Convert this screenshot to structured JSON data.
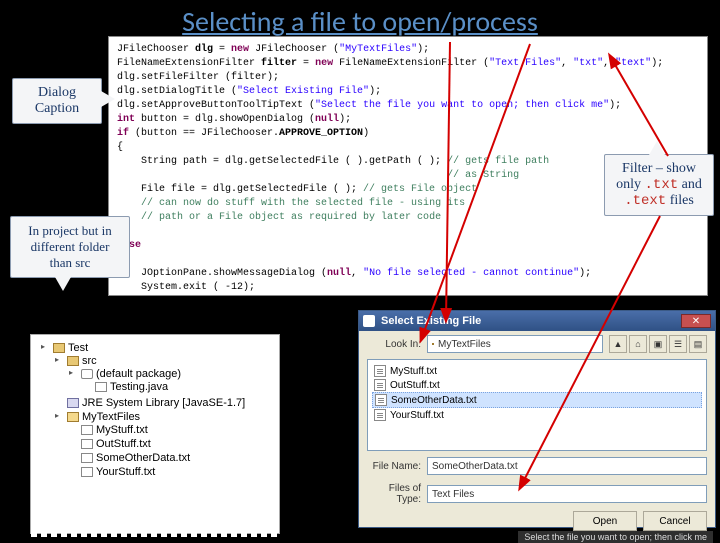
{
  "title": "Selecting a file to open/process",
  "callouts": {
    "dialog_caption": "Dialog Caption",
    "in_project": "In project but in different folder than src",
    "filter_line1": "Filter – show",
    "filter_line2a": "only",
    "filter_ext1": ".txt",
    "filter_line2b": "and",
    "filter_ext2": ".text",
    "filter_line3": "files"
  },
  "code_lines": [
    {
      "html": "JFileChooser <span class='type'>dlg</span> = <span class='kw'>new</span> JFileChooser (<span class='str'>\"MyTextFiles\"</span>);"
    },
    {
      "html": "FileNameExtensionFilter <span class='type'>filter</span> = <span class='kw'>new</span> FileNameExtensionFilter (<span class='str'>\"Text Files\"</span>, <span class='str'>\"txt\"</span>, <span class='str'>\"text\"</span>);"
    },
    {
      "html": "dlg.setFileFilter (filter);"
    },
    {
      "html": "dlg.setDialogTitle (<span class='str'>\"Select Existing File\"</span>);"
    },
    {
      "html": "dlg.setApproveButtonToolTipText (<span class='str'>\"Select the file you want to open; then click me\"</span>);"
    },
    {
      "html": "<span class='kw'>int</span> button = dlg.showOpenDialog (<span class='kw'>null</span>);"
    },
    {
      "html": "<span class='kw'>if</span> (button == JFileChooser.<span class='type'>APPROVE_OPTION</span>)"
    },
    {
      "html": "{"
    },
    {
      "html": "    String path = dlg.getSelectedFile ( ).getPath ( ); <span class='cmt'>// gets file path</span>"
    },
    {
      "html": "                                                       <span class='cmt'>// as String</span>"
    },
    {
      "html": "    File file = dlg.getSelectedFile ( ); <span class='cmt'>// gets File object</span>"
    },
    {
      "html": "    <span class='cmt'>// can now do stuff with the selected file - using its</span>"
    },
    {
      "html": "    <span class='cmt'>// path or a File object as required by later code</span>"
    },
    {
      "html": "}"
    },
    {
      "html": "<span class='kw'>else</span>"
    },
    {
      "html": "{"
    },
    {
      "html": "    JOptionPane.showMessageDialog (<span class='kw'>null</span>, <span class='str'>\"No file selected - cannot continue\"</span>);"
    },
    {
      "html": "    System.exit ( <span class='num'>-12</span>);"
    },
    {
      "html": "}"
    }
  ],
  "tree": {
    "root": "Test",
    "src": "src",
    "pkg": "(default package)",
    "java": "Testing.java",
    "lib": "JRE System Library [JavaSE-1.7]",
    "folder": "MyTextFiles",
    "files": [
      "MyStuff.txt",
      "OutStuff.txt",
      "SomeOtherData.txt",
      "YourStuff.txt"
    ]
  },
  "filechooser": {
    "title": "Select Existing File",
    "look_in_label": "Look In:",
    "look_in_value": "MyTextFiles",
    "files": [
      "MyStuff.txt",
      "OutStuff.txt",
      "SomeOtherData.txt",
      "YourStuff.txt"
    ],
    "selected": "SomeOtherData.txt",
    "file_name_label": "File Name:",
    "file_name_value": "SomeOtherData.txt",
    "file_type_label": "Files of Type:",
    "file_type_value": "Text Files",
    "open_btn": "Open",
    "cancel_btn": "Cancel",
    "tooltip": "Select the file you want to open; then click me"
  }
}
